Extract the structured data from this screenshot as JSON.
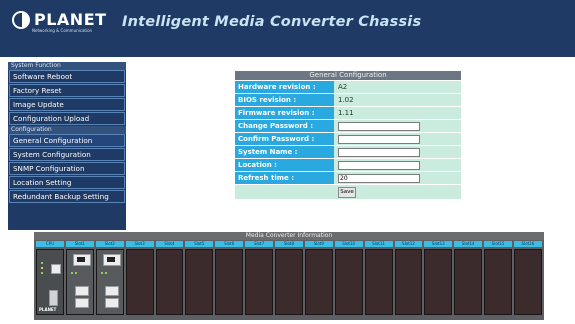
{
  "header": {
    "brand": "PLANET",
    "brand_sub": "Networking & Communication",
    "title": "Intelligent Media Converter Chassis"
  },
  "sidebar": {
    "sections": [
      {
        "heading": "System Function",
        "items": [
          "Software Reboot",
          "Factory Reset",
          "Image Update",
          "Configuration Upload"
        ]
      },
      {
        "heading": "Configuration",
        "items": [
          "General Configuration",
          "System Configuration",
          "SNMP Configuration",
          "Location Setting",
          "Redundant Backup Setting"
        ]
      }
    ],
    "active_item": "General Configuration"
  },
  "config": {
    "heading": "General Configuration",
    "hardware_label": "Hardware revision :",
    "hardware_value": "A2",
    "bios_label": "BIOS revision :",
    "bios_value": "1.02",
    "firmware_label": "Firmware revision :",
    "firmware_value": "1.11",
    "change_password_label": "Change Password :",
    "confirm_password_label": "Confirm Password :",
    "system_name_label": "System Name :",
    "location_label": "Location :",
    "refresh_label": "Refresh time :",
    "refresh_value": "20",
    "save_label": "Save"
  },
  "chassis": {
    "heading": "Media Converter Information",
    "slots": [
      "CPU",
      "Slot1",
      "Slot2",
      "Slot3",
      "Slot4",
      "Slot5",
      "Slot6",
      "Slot7",
      "Slot8",
      "Slot9",
      "Slot10",
      "Slot11",
      "Slot12",
      "Slot13",
      "Slot14",
      "Slot15",
      "Slot16"
    ],
    "cpu_logo": "PLANET"
  },
  "colors": {
    "header_bg": "#1f3a64",
    "label_bg": "#2aa9e1",
    "value_bg": "#c9ecde",
    "slot_empty": "#3c2b2c"
  }
}
